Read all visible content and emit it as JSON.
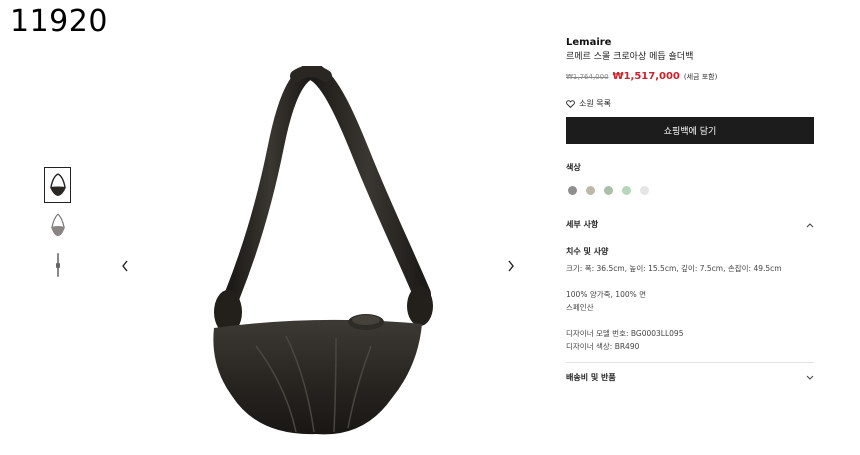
{
  "corner_id": "11920",
  "gallery": {
    "thumbnails": [
      {
        "name": "bag-front-thumb",
        "active": true
      },
      {
        "name": "bag-side-thumb",
        "active": false
      },
      {
        "name": "bag-strap-thumb",
        "active": false
      }
    ],
    "prev_icon": "chevron-left-icon",
    "next_icon": "chevron-right-icon"
  },
  "product": {
    "brand": "Lemaire",
    "name": "르메르 스몰 크로아상 메듭 숄더백",
    "original_price": "₩1,764,000",
    "sale_price": "₩1,517,000",
    "tax_note": "(세금 포함)",
    "wishlist_label": "소원 목록",
    "add_to_cart_label": "쇼핑백에 담기",
    "color_title": "색상",
    "swatches": [
      "#8f8f8f",
      "#bdb9a8",
      "#a9bfa7",
      "#b5d6b8",
      "#e3e5e6"
    ]
  },
  "details": {
    "title": "세부 사항",
    "size_title": "치수 및 사양",
    "dimensions": "크기: 폭: 36.5cm, 높이: 15.5cm, 깊이: 7.5cm, 손잡이: 49.5cm",
    "material": "100% 양가죽, 100% 면",
    "origin": "스페인산",
    "model_number": "디자이너 모델 번호: BG0003LL095",
    "designer_color": "디자이너 색상: BR490"
  },
  "shipping": {
    "title": "배송비 및 반품"
  },
  "colors": {
    "sale": "#c8242c",
    "button": "#1c1c1c"
  }
}
